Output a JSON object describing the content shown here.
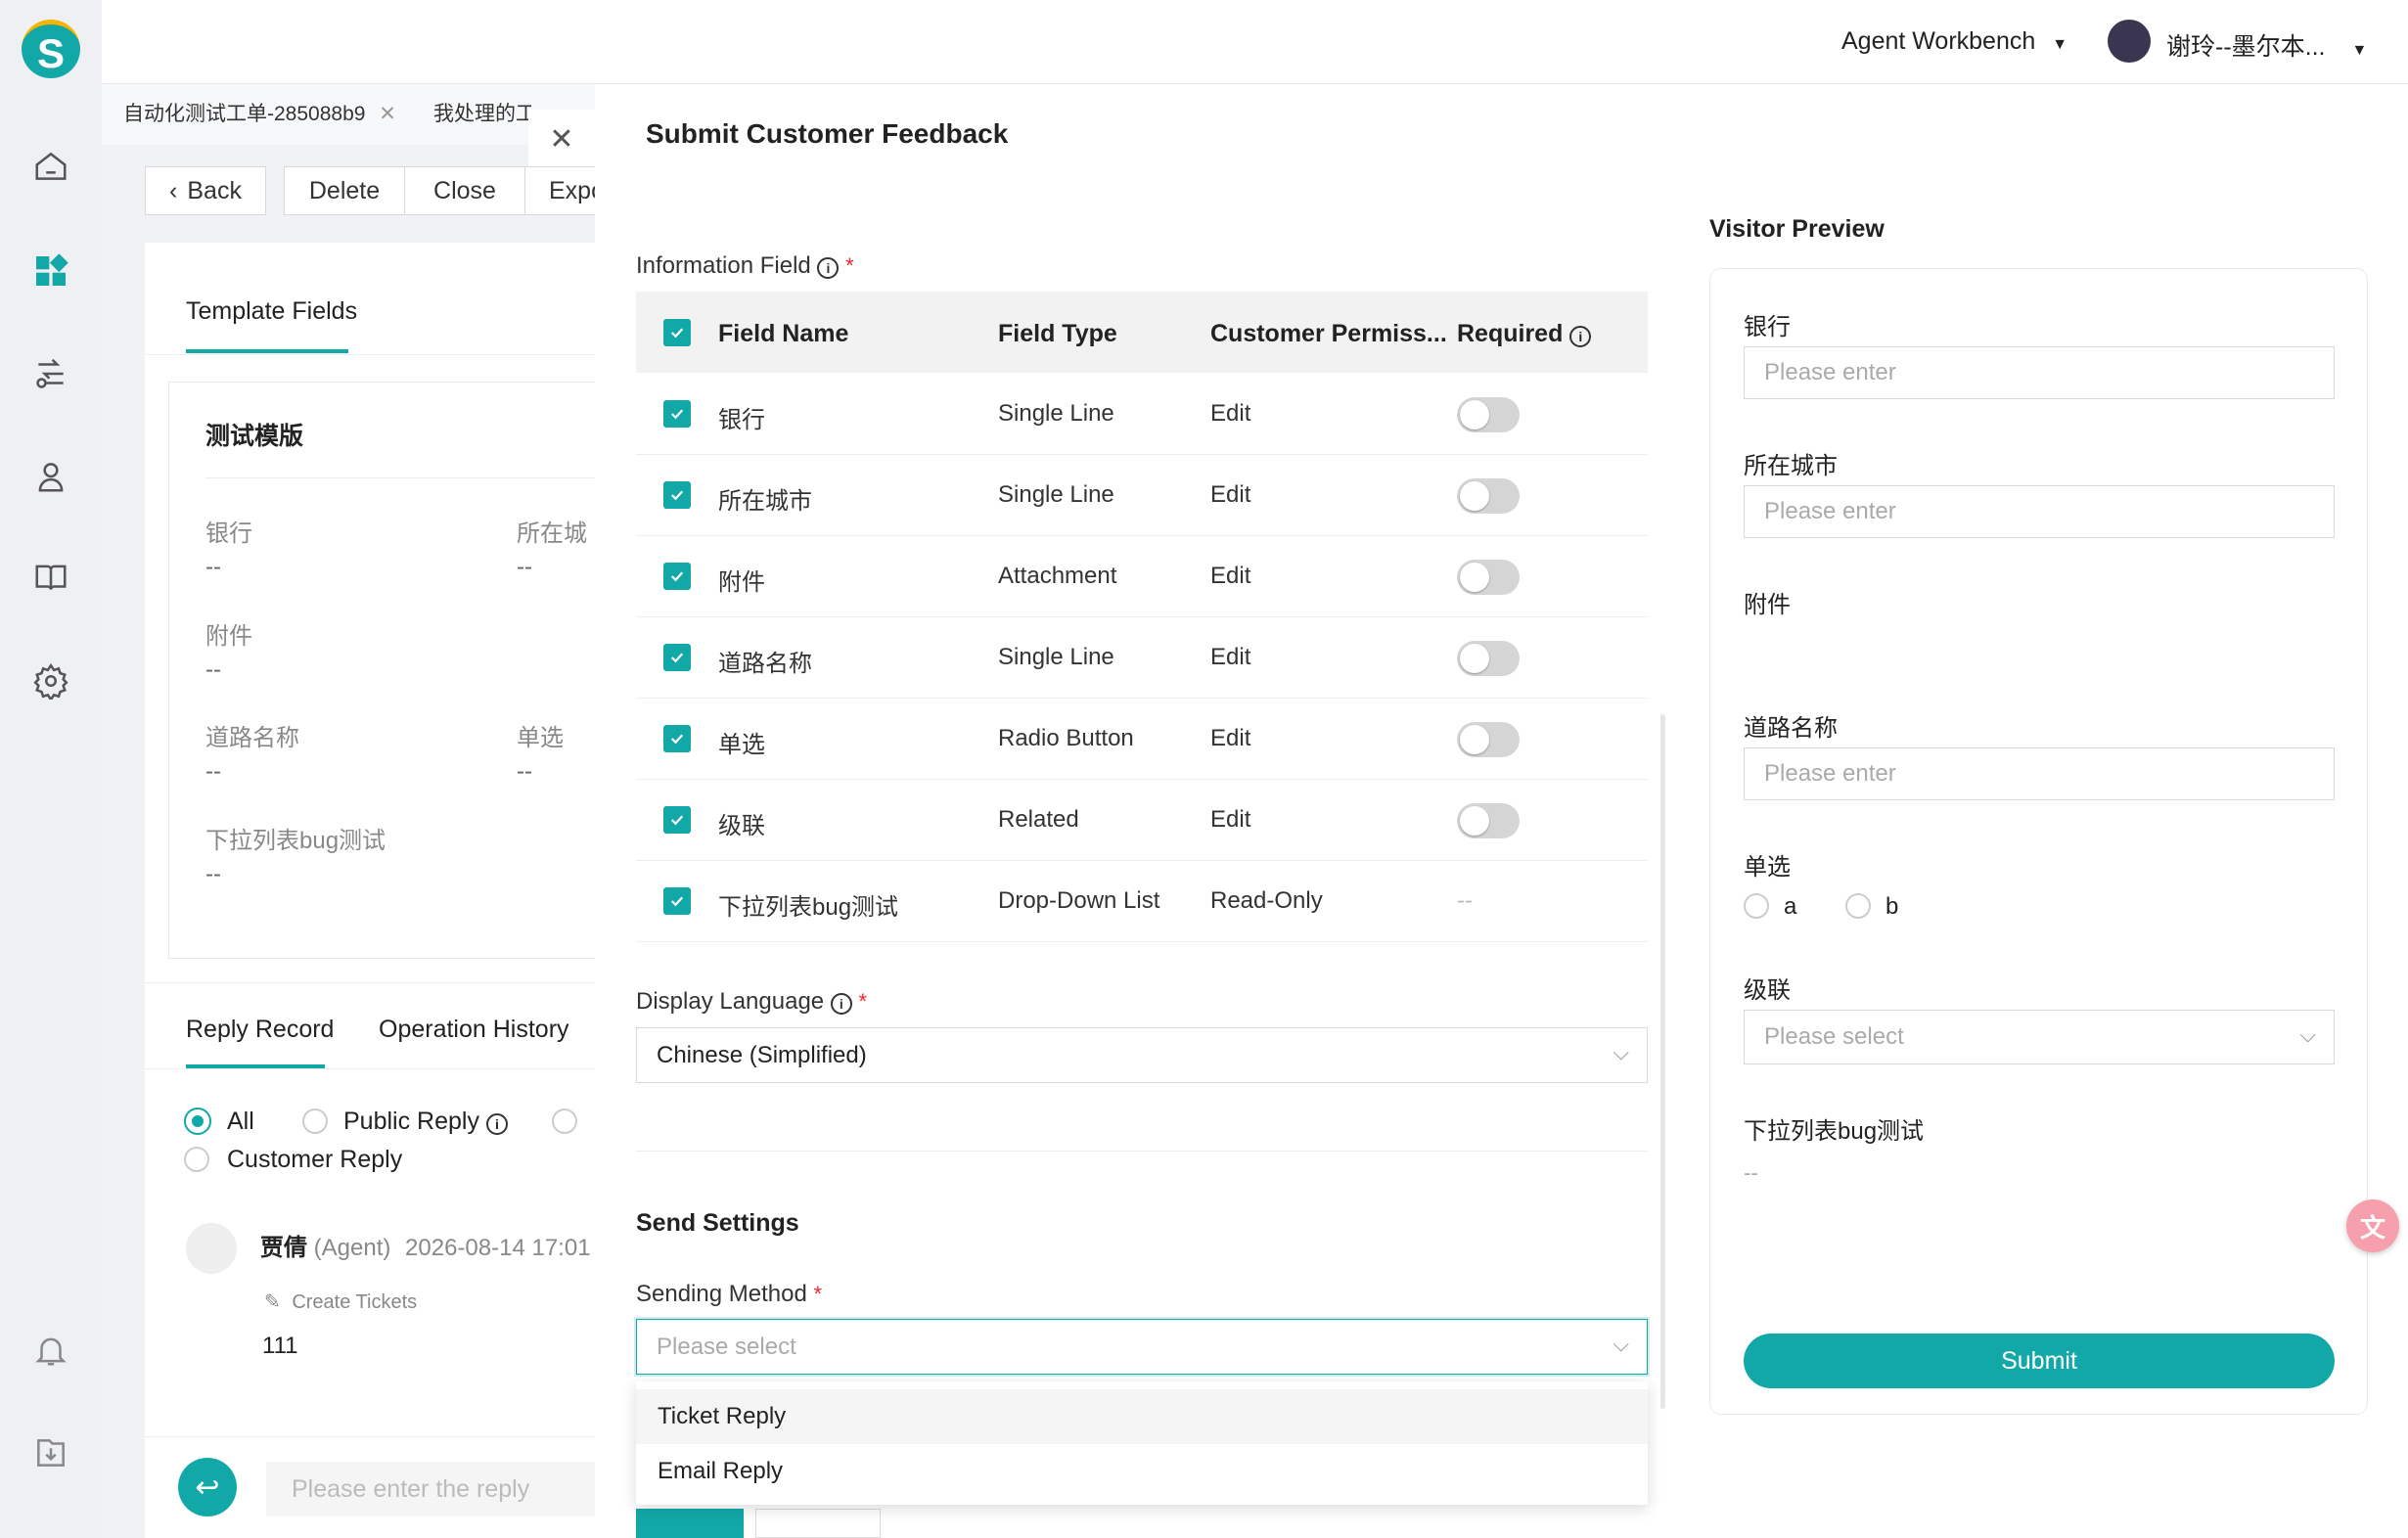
{
  "app": {
    "logo_letter": "S"
  },
  "topbar": {
    "workbench": "Agent Workbench",
    "user": "谢玲--墨尔本..."
  },
  "tabs": [
    {
      "label": "自动化测试工单-285088b9"
    },
    {
      "label": "我处理的工"
    }
  ],
  "toolbar": {
    "back": "Back",
    "delete": "Delete",
    "close": "Close",
    "export": "Expo"
  },
  "ticket": {
    "section_tab": "Template Fields",
    "template_name": "测试模版",
    "fields": [
      {
        "label": "银行",
        "value": "--"
      },
      {
        "label": "所在城市",
        "value": "--"
      },
      {
        "label": "附件",
        "value": "--"
      },
      {
        "label": "道路名称",
        "value": "--"
      },
      {
        "label": "单选",
        "value": "--"
      },
      {
        "label": "下拉列表bug测试",
        "value": "--"
      }
    ],
    "field_label_city_short": "所在城",
    "reply_tabs": [
      "Reply Record",
      "Operation History"
    ],
    "filters": [
      "All",
      "Public Reply",
      "Customer Reply"
    ],
    "record": {
      "author": "贾倩",
      "role": "(Agent)",
      "time": "2026-08-14 17:01",
      "action": "Create Tickets",
      "content": "111"
    },
    "reply_placeholder": "Please enter the reply"
  },
  "drawer": {
    "title": "Submit Customer Feedback",
    "info_field_label": "Information Field",
    "table_headers": [
      "Field Name",
      "Field Type",
      "Customer Permiss...",
      "Required"
    ],
    "rows": [
      {
        "name": "银行",
        "type": "Single Line",
        "perm": "Edit",
        "required": "off"
      },
      {
        "name": "所在城市",
        "type": "Single Line",
        "perm": "Edit",
        "required": "off"
      },
      {
        "name": "附件",
        "type": "Attachment",
        "perm": "Edit",
        "required": "off"
      },
      {
        "name": "道路名称",
        "type": "Single Line",
        "perm": "Edit",
        "required": "off"
      },
      {
        "name": "单选",
        "type": "Radio Button",
        "perm": "Edit",
        "required": "off"
      },
      {
        "name": "级联",
        "type": "Related",
        "perm": "Edit",
        "required": "off"
      },
      {
        "name": "下拉列表bug测试",
        "type": "Drop-Down List",
        "perm": "Read-Only",
        "required": "--"
      }
    ],
    "display_language_label": "Display Language",
    "display_language_value": "Chinese (Simplified)",
    "send_settings": "Send Settings",
    "sending_method_label": "Sending Method",
    "sending_method_placeholder": "Please select",
    "options": [
      "Ticket Reply",
      "Email Reply"
    ]
  },
  "preview": {
    "title": "Visitor Preview",
    "fields": [
      {
        "label": "银行",
        "placeholder": "Please enter"
      },
      {
        "label": "所在城市",
        "placeholder": "Please enter"
      },
      {
        "label": "附件"
      },
      {
        "label": "道路名称",
        "placeholder": "Please enter"
      },
      {
        "label": "单选",
        "options": [
          "a",
          "b"
        ]
      },
      {
        "label": "级联",
        "placeholder": "Please select"
      },
      {
        "label": "下拉列表bug测试",
        "value": "--"
      }
    ],
    "submit": "Submit"
  },
  "colors": {
    "accent": "#13a8a8",
    "required_star": "#f5222d"
  }
}
